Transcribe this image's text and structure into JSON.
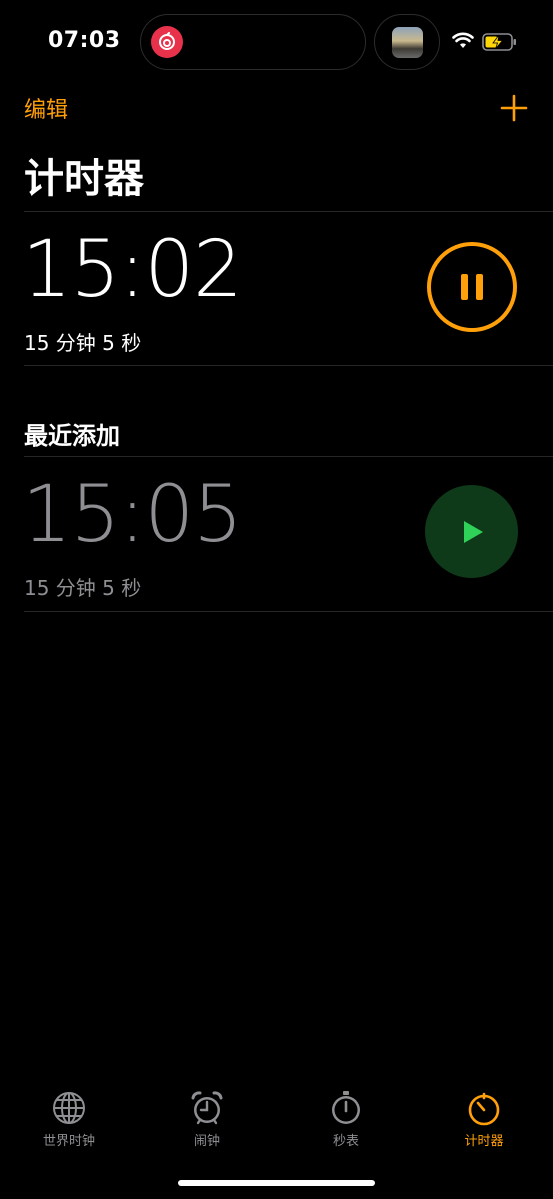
{
  "status_bar": {
    "time": "07:03",
    "left_app_icon": "netease-music-icon",
    "right_thumbnail": "media-thumbnail",
    "wifi_icon": "wifi-icon",
    "battery_icon": "battery-charging-icon"
  },
  "nav": {
    "edit_label": "编辑",
    "add_icon": "plus-icon",
    "title": "计时器"
  },
  "active_timer": {
    "remaining": "15:02",
    "label": "15 分钟 5 秒",
    "control_icon": "pause-icon"
  },
  "recent": {
    "heading": "最近添加",
    "items": [
      {
        "time": "15:05",
        "label": "15 分钟 5 秒",
        "control_icon": "play-icon"
      }
    ]
  },
  "tab_bar": {
    "tabs": [
      {
        "label": "世界时钟",
        "icon": "globe-icon"
      },
      {
        "label": "闹钟",
        "icon": "alarm-clock-icon"
      },
      {
        "label": "秒表",
        "icon": "stopwatch-icon"
      },
      {
        "label": "计时器",
        "icon": "timer-icon",
        "selected": true
      }
    ]
  },
  "colors": {
    "accent": "#ff9f0a",
    "play_green": "#30d158",
    "play_bg": "#0f3a1a",
    "inactive_gray": "#8e8e93",
    "background": "#000000"
  }
}
